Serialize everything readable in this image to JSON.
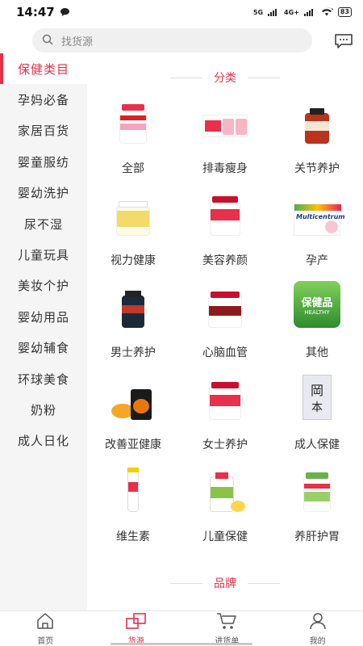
{
  "status_bar": {
    "time": "14:47",
    "network": "5G",
    "network2": "4G+",
    "battery": "83"
  },
  "search": {
    "placeholder": "找货源"
  },
  "sidebar": {
    "items": [
      {
        "label": "保健类目",
        "active": true
      },
      {
        "label": "孕妈必备"
      },
      {
        "label": "家居百货"
      },
      {
        "label": "婴童服纺"
      },
      {
        "label": "婴幼洗护"
      },
      {
        "label": "尿不湿"
      },
      {
        "label": "儿童玩具"
      },
      {
        "label": "美妆个护"
      },
      {
        "label": "婴幼用品"
      },
      {
        "label": "婴幼辅食"
      },
      {
        "label": "环球美食"
      },
      {
        "label": "奶粉"
      },
      {
        "label": "成人日化"
      }
    ]
  },
  "main": {
    "category_title": "分类",
    "brand_title": "品牌",
    "categories": [
      {
        "label": "全部"
      },
      {
        "label": "排毒瘦身"
      },
      {
        "label": "关节养护"
      },
      {
        "label": "视力健康"
      },
      {
        "label": "美容养颜"
      },
      {
        "label": "孕产"
      },
      {
        "label": "男士养护"
      },
      {
        "label": "心脑血管"
      },
      {
        "label": "其他"
      },
      {
        "label": "改善亚健康"
      },
      {
        "label": "女士养护"
      },
      {
        "label": "成人保健"
      },
      {
        "label": "维生素"
      },
      {
        "label": "儿童保健"
      },
      {
        "label": "养肝护胃"
      }
    ],
    "other_badge_text": "保健品",
    "other_badge_sub": "HEALTHY",
    "multicentrum_text": "Multicentrum",
    "adult_box_text1": "岡",
    "adult_box_text2": "本"
  },
  "bottom_nav": {
    "items": [
      {
        "label": "首页"
      },
      {
        "label": "货源",
        "active": true
      },
      {
        "label": "进货单"
      },
      {
        "label": "我的"
      }
    ]
  },
  "colors": {
    "accent": "#e8304a",
    "sidebar_bg": "#f5f5f5"
  }
}
